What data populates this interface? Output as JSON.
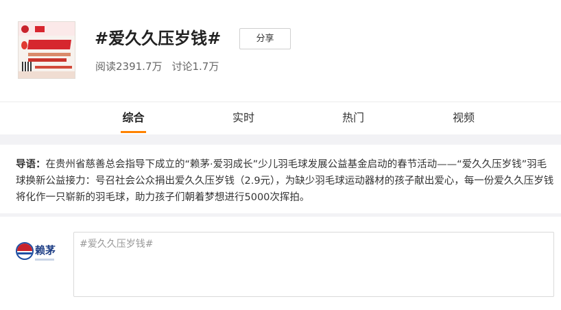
{
  "header": {
    "title": "#爱久久压岁钱#",
    "share_label": "分享",
    "reads": "阅读2391.7万",
    "discussions": "讨论1.7万"
  },
  "tabs": [
    {
      "label": "综合",
      "active": true
    },
    {
      "label": "实时",
      "active": false
    },
    {
      "label": "热门",
      "active": false
    },
    {
      "label": "视频",
      "active": false
    }
  ],
  "intro": {
    "label": "导语：",
    "text": "在贵州省慈善总会指导下成立的“赖茅·爱羽成长”少儿羽毛球发展公益基金启动的春节活动——“爱久久压岁钱”羽毛球换新公益接力：号召社会公众捐出爱久久压岁钱（2.9元），为缺少羽毛球运动器材的孩子献出爱心，每一份爱久久压岁钱将化作一只崭新的羽毛球，助力孩子们朝着梦想进行5000次挥拍。"
  },
  "composer": {
    "brand": "赖茅",
    "value": "#爱久久压岁钱#"
  },
  "colors": {
    "accent": "#ff8200",
    "brand_red": "#c8232c",
    "brand_blue": "#1f4fa3"
  }
}
